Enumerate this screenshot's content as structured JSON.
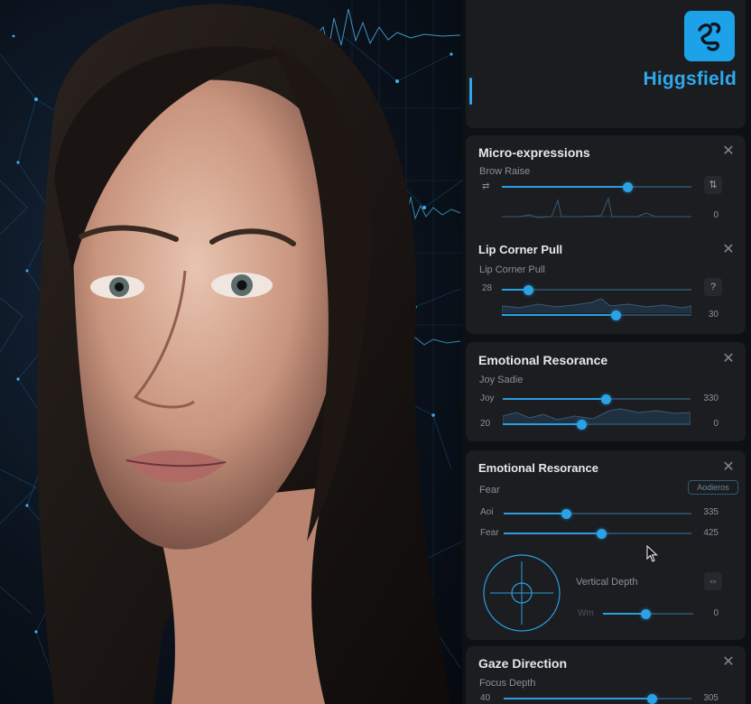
{
  "brand": {
    "name": "Higgsfield",
    "logo_icon": "squiggle-logo-icon",
    "accent": "#1da1e8"
  },
  "panels": {
    "micro": {
      "title": "Micro-expressions",
      "sub": "Brow Raise",
      "left_label": "⇄",
      "btn": "⇅",
      "value": "0",
      "level": 0.66
    },
    "lip": {
      "title": "Lip Corner Pull",
      "sub": "Lip Corner Pull",
      "left_label": "28",
      "btn": "?",
      "value": "30",
      "level_top": 0.14,
      "level_bottom": 0.6
    },
    "emo1": {
      "title": "Emotional Resorance",
      "sub": "Joy Sadie",
      "row1_label": "Joy",
      "row1_value": "330",
      "row2_label": "20",
      "row2_value": "0",
      "level_top": 0.55,
      "level_bottom": 0.42
    },
    "emo2": {
      "title": "Emotional Resorance",
      "sub": "Fear",
      "pill": "Aodieros",
      "row1_label": "Aoi",
      "row1_value": "335",
      "row2_label": "Fear",
      "row2_value": "425",
      "level_top": 0.33,
      "level_bottom": 0.52,
      "depth_label": "Vertical Depth",
      "depth_btn": "⇔",
      "depth_value": "0",
      "depth_sub": "Wm",
      "depth_level": 0.47
    },
    "gaze": {
      "title": "Gaze Direction",
      "sub": "Focus Depth",
      "row1_label": "40",
      "row1_value": "305",
      "level": 0.79
    }
  },
  "close_glyph": "✕"
}
